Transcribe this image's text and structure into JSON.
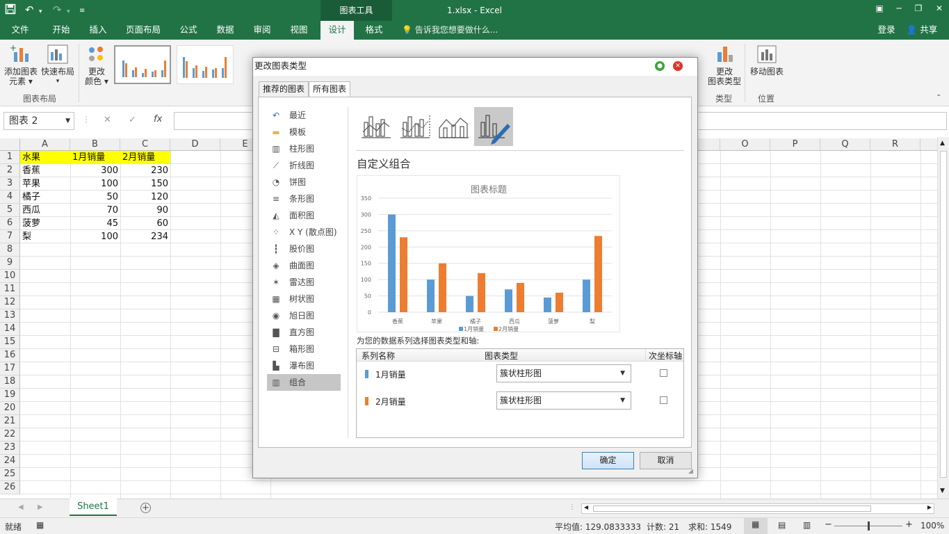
{
  "window": {
    "title": "1.xlsx - Excel",
    "context_tools": "图表工具",
    "icons": [
      "save-icon",
      "undo-icon",
      "redo-icon",
      "customize-quick-access-icon",
      "restore-icon",
      "minimize-icon",
      "maximize-icon",
      "close-icon"
    ]
  },
  "tabs": [
    "文件",
    "开始",
    "插入",
    "页面布局",
    "公式",
    "数据",
    "审阅",
    "视图",
    "设计",
    "格式"
  ],
  "active_tab": "设计",
  "tell_me": "告诉我您想要做什么...",
  "account": {
    "login": "登录",
    "share": "共享"
  },
  "ribbon": {
    "add_element": [
      "添加图表",
      "元素"
    ],
    "quick_layout": "快速布局",
    "change_color": [
      "更改",
      "颜色"
    ],
    "group_layout": "图表布局",
    "change_type": [
      "更改",
      "图表类型"
    ],
    "move_chart": "移动图表",
    "group_type": "类型",
    "group_location": "位置"
  },
  "formula_bar": {
    "name_box": "图表 2",
    "cancel": "✕",
    "confirm": "✓",
    "fx": "fx"
  },
  "grid": {
    "col_headers": [
      "A",
      "B",
      "C",
      "D",
      "E",
      "O",
      "P",
      "Q",
      "R"
    ],
    "row_headers": [
      "1",
      "2",
      "3",
      "4",
      "5",
      "6",
      "7",
      "8",
      "9",
      "10",
      "11",
      "12",
      "13",
      "14",
      "15",
      "16",
      "17",
      "18",
      "19",
      "20",
      "21",
      "22",
      "23",
      "24",
      "25",
      "26"
    ],
    "header_row": [
      "水果",
      "1月销量",
      "2月销量"
    ],
    "rows": [
      [
        "香蕉",
        "300",
        "230"
      ],
      [
        "苹果",
        "100",
        "150"
      ],
      [
        "橘子",
        "50",
        "120"
      ],
      [
        "西瓜",
        "70",
        "90"
      ],
      [
        "菠萝",
        "45",
        "60"
      ],
      [
        "梨",
        "100",
        "234"
      ]
    ],
    "header_fill": "#FFFF00"
  },
  "sheet_tab": "Sheet1",
  "status": {
    "ready": "就绪",
    "average": "平均值: 129.0833333",
    "count": "计数: 21",
    "sum": "求和: 1549",
    "zoom": "100%",
    "zoom_level": 100
  },
  "dialog": {
    "title": "更改图表类型",
    "tabs": [
      "推荐的图表",
      "所有图表"
    ],
    "active_tab": "所有图表",
    "nav": [
      {
        "label": "最近",
        "icon": "recent-icon"
      },
      {
        "label": "模板",
        "icon": "folder-icon"
      },
      {
        "label": "柱形图",
        "icon": "column-chart-icon"
      },
      {
        "label": "折线图",
        "icon": "line-chart-icon"
      },
      {
        "label": "饼图",
        "icon": "pie-chart-icon"
      },
      {
        "label": "条形图",
        "icon": "bar-chart-icon"
      },
      {
        "label": "面积图",
        "icon": "area-chart-icon"
      },
      {
        "label": "X Y (散点图)",
        "icon": "scatter-chart-icon"
      },
      {
        "label": "股价图",
        "icon": "stock-chart-icon"
      },
      {
        "label": "曲面图",
        "icon": "surface-chart-icon"
      },
      {
        "label": "雷达图",
        "icon": "radar-chart-icon"
      },
      {
        "label": "树状图",
        "icon": "treemap-chart-icon"
      },
      {
        "label": "旭日图",
        "icon": "sunburst-chart-icon"
      },
      {
        "label": "直方图",
        "icon": "histogram-chart-icon"
      },
      {
        "label": "箱形图",
        "icon": "box-whisker-chart-icon"
      },
      {
        "label": "瀑布图",
        "icon": "waterfall-chart-icon"
      },
      {
        "label": "组合",
        "icon": "combo-chart-icon"
      }
    ],
    "selected_nav": "组合",
    "section_title": "自定义组合",
    "series_prompt": "为您的数据系列选择图表类型和轴:",
    "table_headers": [
      "系列名称",
      "图表类型",
      "次坐标轴"
    ],
    "series": [
      {
        "name": "1月销量",
        "type": "簇状柱形图",
        "secondary": false,
        "color": "#5B9BD5"
      },
      {
        "name": "2月销量",
        "type": "簇状柱形图",
        "secondary": false,
        "color": "#ED7D31"
      }
    ],
    "ok": "确定",
    "cancel": "取消"
  },
  "chart_data": {
    "type": "bar",
    "title": "图表标题",
    "categories": [
      "香蕉",
      "苹果",
      "橘子",
      "西瓜",
      "菠萝",
      "梨"
    ],
    "series": [
      {
        "name": "1月销量",
        "values": [
          300,
          100,
          50,
          70,
          45,
          100
        ],
        "color": "#5B9BD5"
      },
      {
        "name": "2月销量",
        "values": [
          230,
          150,
          120,
          90,
          60,
          234
        ],
        "color": "#ED7D31"
      }
    ],
    "ylim": [
      0,
      350
    ],
    "yticks": [
      0,
      50,
      100,
      150,
      200,
      250,
      300,
      350
    ],
    "grid": true,
    "legend": "bottom"
  }
}
